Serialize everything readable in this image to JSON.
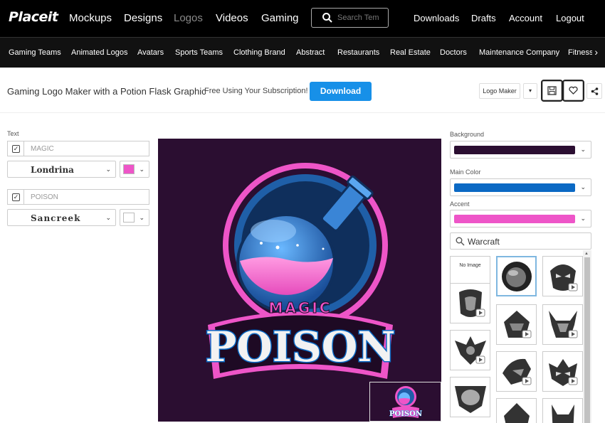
{
  "topnav": {
    "brand": "Placeit",
    "links": [
      "Mockups",
      "Designs",
      "Logos",
      "Videos",
      "Gaming"
    ],
    "search_placeholder": "Search Tem",
    "right_links": [
      "Downloads",
      "Drafts",
      "Account",
      "Logout"
    ]
  },
  "categories": [
    "Gaming Teams",
    "Animated Logos",
    "Avatars",
    "Sports Teams",
    "Clothing Brand",
    "Abstract",
    "Restaurants",
    "Real Estate",
    "Doctors",
    "Maintenance Company",
    "Fitness"
  ],
  "titlebar": {
    "title": "Gaming Logo Maker with a Potion Flask Graphic",
    "subtitle": "Free Using Your Subscription!",
    "download_label": "Download",
    "logo_maker_label": "Logo Maker",
    "dropdown_glyph": "▾"
  },
  "left_panel": {
    "section_label": "Text",
    "text1": {
      "value": "MAGIC",
      "font": "Londrina",
      "color": "#ee55c8"
    },
    "text2": {
      "value": "POISON",
      "font": "Sancreek",
      "color": "#ffffff"
    }
  },
  "logo": {
    "word1": "MAGIC",
    "word2": "POISON"
  },
  "right_panel": {
    "background_label": "Background",
    "background_color": "#2b0e31",
    "main_color_label": "Main Color",
    "main_color": "#0b69c4",
    "accent_label": "Accent",
    "accent_color": "#ee55c8",
    "search_value": "Warcraft",
    "no_image_label": "No Image"
  },
  "colors": {
    "nav_bg": "#000000",
    "download_blue": "#1790e8",
    "canvas_bg": "#2b0e31"
  }
}
